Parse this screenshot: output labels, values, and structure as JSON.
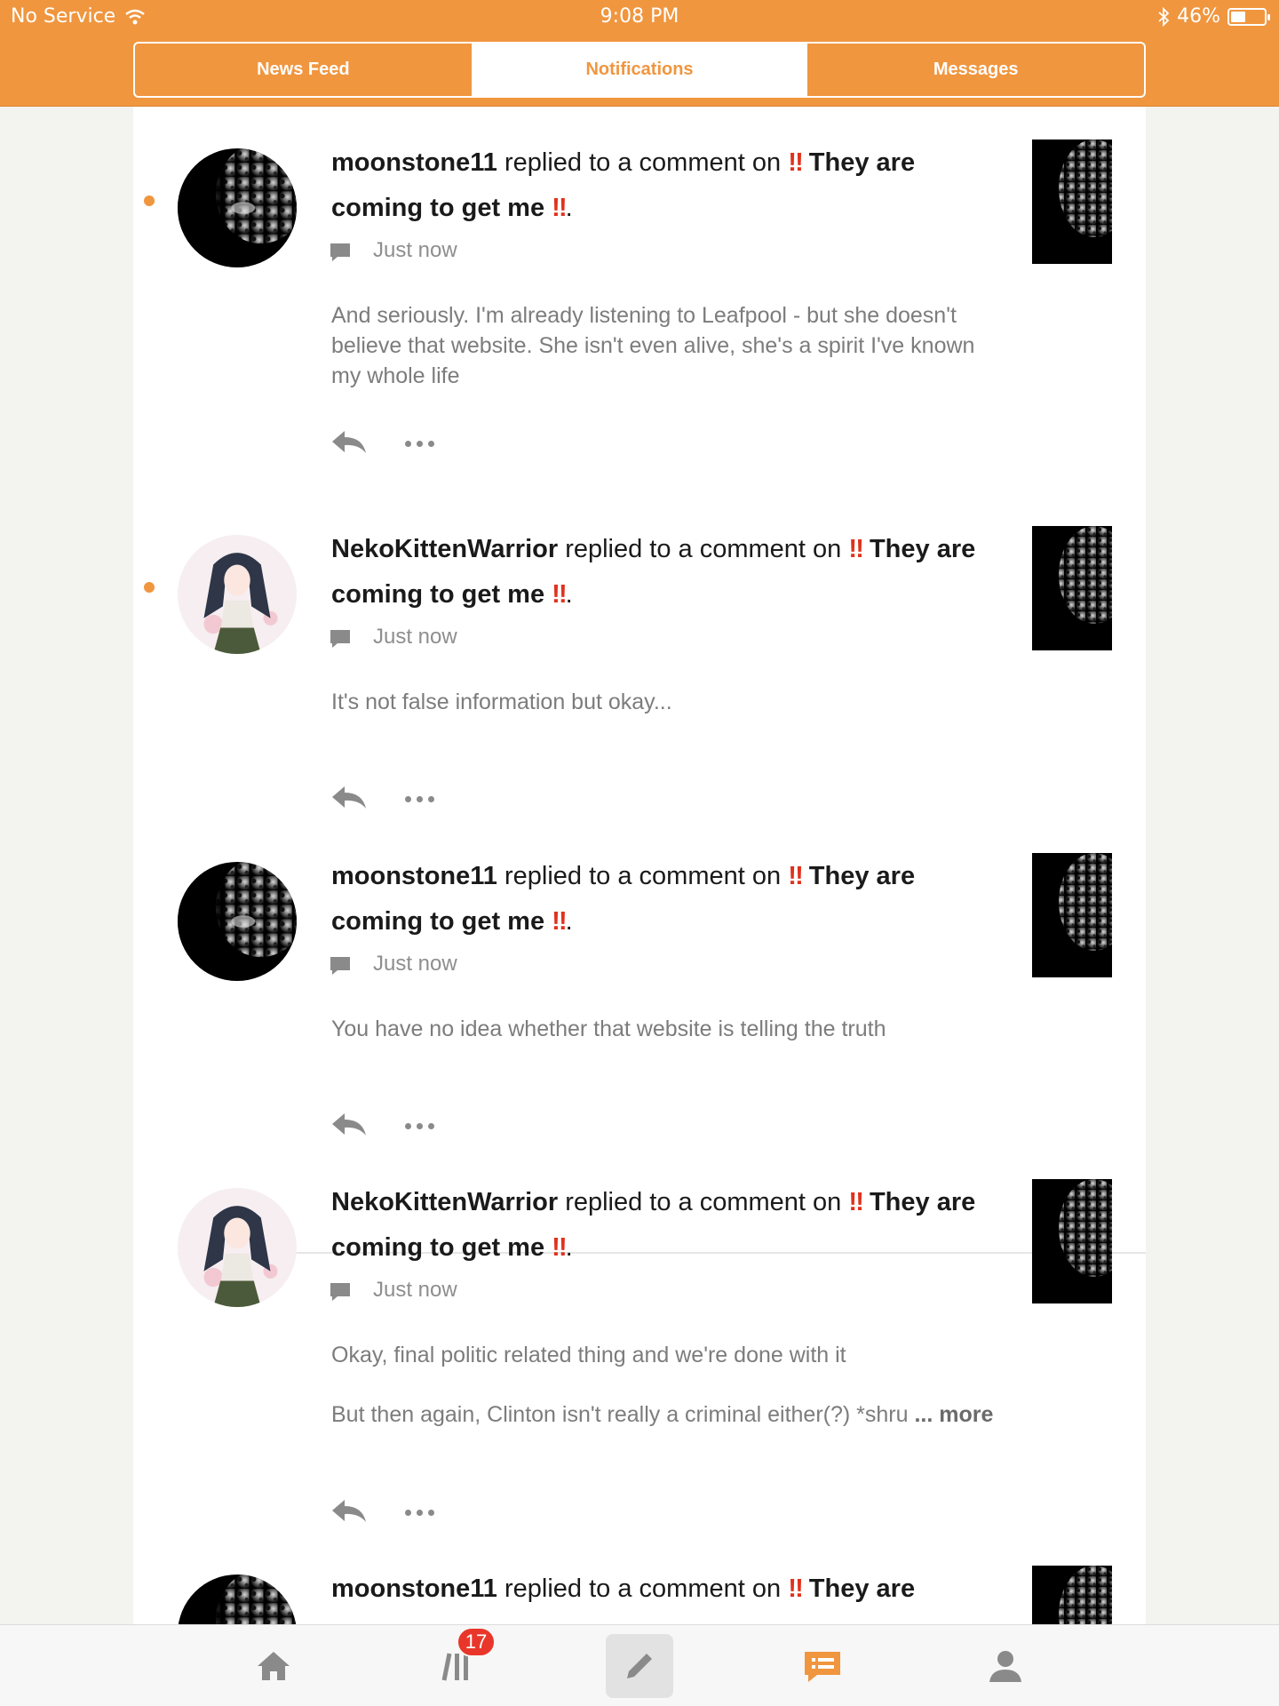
{
  "status_bar": {
    "carrier": "No Service",
    "time": "9:08 PM",
    "battery": "46%",
    "battery_level": 0.46
  },
  "tabs": [
    {
      "label": "News Feed",
      "active": false
    },
    {
      "label": "Notifications",
      "active": true
    },
    {
      "label": "Messages",
      "active": false
    }
  ],
  "notifications": [
    {
      "user": "moonstone11",
      "action": "replied to a comment on",
      "story_part1": "They are",
      "story_part2": "coming to get me",
      "bang": "‼",
      "period": ".",
      "time": "Just now",
      "unread": true,
      "avatar": "leopard",
      "body": [
        "And seriously. I'm already listening to Leafpool - but she doesn't believe that website. She isn't even alive, she's a spirit I've known my whole life"
      ]
    },
    {
      "user": "NekoKittenWarrior",
      "action": "replied to a comment on",
      "story_part1": "They are",
      "story_part2": "coming to get me",
      "bang": "‼",
      "period": ".",
      "time": "Just now",
      "unread": true,
      "avatar": "anime-girl",
      "body": [
        "It's not false information but okay..."
      ]
    },
    {
      "user": "moonstone11",
      "action": "replied to a comment on",
      "story_part1": "They are",
      "story_part2": "coming to get me",
      "bang": "‼",
      "period": ".",
      "time": "Just now",
      "unread": false,
      "avatar": "leopard",
      "body": [
        "You have no idea whether that website is telling the truth"
      ]
    },
    {
      "user": "NekoKittenWarrior",
      "action": "replied to a comment on",
      "story_part1": "They are",
      "story_part2": "coming to get me",
      "bang": "‼",
      "period": ".",
      "time": "Just now",
      "unread": false,
      "avatar": "anime-girl",
      "body": [
        "Okay, final politic related thing and we're done with it",
        "But then again, Clinton isn't really a criminal either(?) *shru"
      ],
      "more": "... more"
    },
    {
      "user": "moonstone11",
      "action": "replied to a comment on",
      "story_part1": "They are",
      "bang": "‼",
      "avatar": "leopard"
    }
  ],
  "bottom_nav": {
    "items": [
      "home-icon",
      "library-icon",
      "pencil-icon",
      "notifications-icon",
      "profile-icon"
    ],
    "library_badge": "17",
    "accent": "#f0963f"
  },
  "colors": {
    "accent": "#f0963f",
    "bang": "#e0321c"
  }
}
